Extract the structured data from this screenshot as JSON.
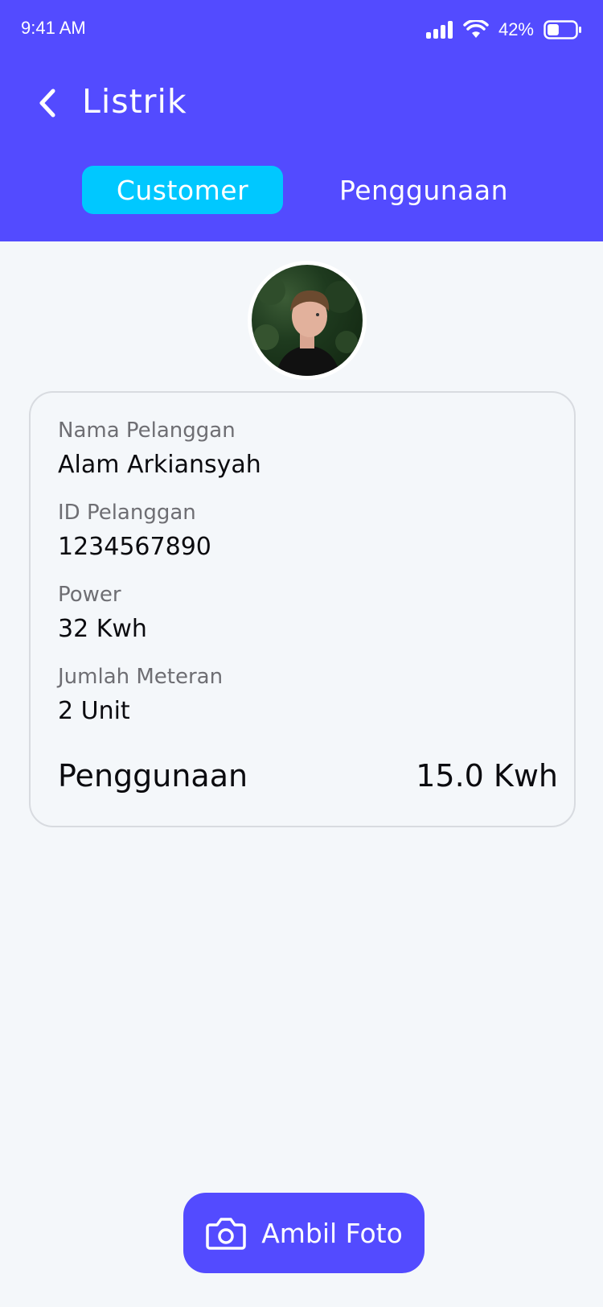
{
  "status_bar": {
    "time": "9:41 AM",
    "battery_percent": "42%",
    "battery_level": 0.42
  },
  "header": {
    "title": "Listrik",
    "back_icon": "chevron-left-icon"
  },
  "tabs": [
    {
      "label": "Customer",
      "active": true
    },
    {
      "label": "Penggunaan",
      "active": false
    }
  ],
  "customer": {
    "fields": [
      {
        "label": "Nama Pelanggan",
        "value": "Alam Arkiansyah"
      },
      {
        "label": "ID Pelanggan",
        "value": "1234567890"
      },
      {
        "label": "Power",
        "value": "32 Kwh"
      },
      {
        "label": "Jumlah Meteran",
        "value": "2 Unit"
      }
    ],
    "usage_label": "Penggunaan",
    "usage_value": "15.0 Kwh"
  },
  "action": {
    "label": "Ambil Foto",
    "icon": "camera-icon"
  },
  "colors": {
    "primary": "#534BFF",
    "tab_active": "#00C8FF",
    "background": "#F4F7FA"
  }
}
